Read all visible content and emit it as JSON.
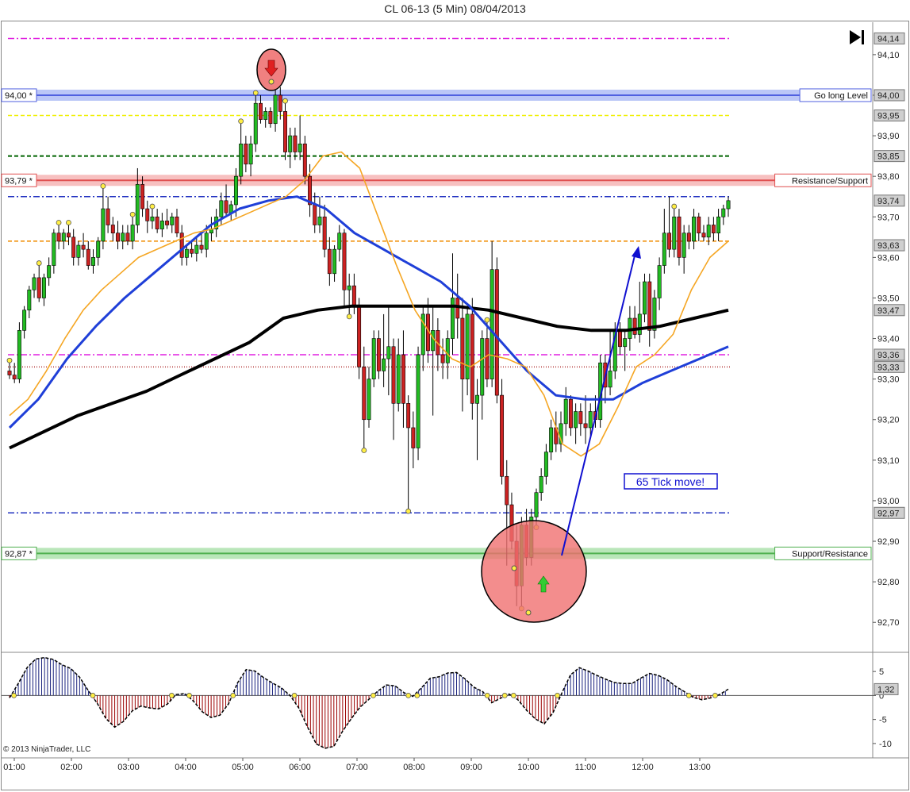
{
  "title": "CL 06-13 (5 Min)  08/04/2013",
  "copyright": "© 2013 NinjaTrader, LLC",
  "colors": {
    "up": "#22bb22",
    "down": "#cc2222",
    "sma_fast": "#f5a623",
    "sma_mid": "#1f3fd8",
    "sma_slow": "#000000",
    "osc_up": "#1a237e",
    "osc_down": "#9b0000"
  },
  "chart_data": [
    {
      "type": "candlestick",
      "ylim": [
        92.63,
        94.18
      ],
      "x_labels": [
        "01:00",
        "02:00",
        "03:00",
        "04:00",
        "05:00",
        "06:00",
        "07:00",
        "08:00",
        "09:00",
        "10:00",
        "11:00",
        "12:00",
        "13:00"
      ],
      "y_ticks": [
        "94,10",
        "94,00",
        "93,90",
        "93,80",
        "93,70",
        "93,60",
        "93,50",
        "93,40",
        "93,30",
        "93,20",
        "93,10",
        "93,00",
        "92,90",
        "92,80",
        "92,70"
      ],
      "y_tick_values": [
        94.1,
        94.0,
        93.9,
        93.8,
        93.7,
        93.6,
        93.5,
        93.4,
        93.3,
        93.2,
        93.1,
        93.0,
        92.9,
        92.8,
        92.7
      ],
      "price_tags": [
        {
          "label": "94,14",
          "value": 94.14,
          "color": "#cfcfcf"
        },
        {
          "label": "94,00",
          "value": 94.0,
          "color": "#cfcfcf"
        },
        {
          "label": "93,95",
          "value": 93.95,
          "color": "#cfcfcf"
        },
        {
          "label": "93,85",
          "value": 93.85,
          "color": "#cfcfcf"
        },
        {
          "label": "93,74",
          "value": 93.74,
          "color": "#cfcfcf"
        },
        {
          "label": "93,63",
          "value": 93.63,
          "color": "#cfcfcf"
        },
        {
          "label": "93,47",
          "value": 93.47,
          "color": "#cfcfcf"
        },
        {
          "label": "93,36",
          "value": 93.36,
          "color": "#cfcfcf"
        },
        {
          "label": "93,33",
          "value": 93.33,
          "color": "#cfcfcf"
        },
        {
          "label": "92,97",
          "value": 92.97,
          "color": "#cfcfcf"
        }
      ],
      "horizontal_lines": [
        {
          "value": 94.14,
          "color": "#e020e0",
          "style": "dashdot"
        },
        {
          "value": 93.95,
          "color": "#f0f000",
          "style": "dash"
        },
        {
          "value": 93.85,
          "color": "#006400",
          "style": "dash"
        },
        {
          "value": 93.75,
          "color": "#2030c0",
          "style": "dashdot"
        },
        {
          "value": 93.64,
          "color": "#f08c00",
          "style": "dash"
        },
        {
          "value": 93.36,
          "color": "#e020e0",
          "style": "dashdot"
        },
        {
          "value": 93.33,
          "color": "#b03030",
          "style": "dot"
        },
        {
          "value": 92.97,
          "color": "#2030c0",
          "style": "dashdot"
        }
      ],
      "zones": [
        {
          "value": 94.0,
          "left_label": "94,00 *",
          "right_label": "Go long Level",
          "fill": "#aab8f5",
          "line": "#5060e0"
        },
        {
          "value": 93.79,
          "left_label": "93,79 *",
          "right_label": "Resistance/Support",
          "fill": "#f5b0b0",
          "line": "#e05050"
        },
        {
          "value": 92.87,
          "left_label": "92,87 *",
          "right_label": "Support/Resistance",
          "fill": "#a8e0a8",
          "line": "#50b050"
        }
      ],
      "annotation": "65 Tick move!",
      "candles": [
        [
          93.32,
          93.34,
          93.3,
          93.31
        ],
        [
          93.31,
          93.34,
          93.29,
          93.3
        ],
        [
          93.3,
          93.44,
          93.29,
          93.42
        ],
        [
          93.42,
          93.48,
          93.4,
          93.47
        ],
        [
          93.47,
          93.53,
          93.45,
          93.52
        ],
        [
          93.52,
          93.56,
          93.5,
          93.55
        ],
        [
          93.55,
          93.58,
          93.49,
          93.5
        ],
        [
          93.5,
          93.56,
          93.48,
          93.55
        ],
        [
          93.55,
          93.6,
          93.53,
          93.58
        ],
        [
          93.58,
          93.67,
          93.56,
          93.66
        ],
        [
          93.66,
          93.68,
          93.62,
          93.64
        ],
        [
          93.64,
          93.67,
          93.62,
          93.66
        ],
        [
          93.66,
          93.68,
          93.63,
          93.65
        ],
        [
          93.65,
          93.67,
          93.58,
          93.6
        ],
        [
          93.6,
          93.64,
          93.58,
          93.63
        ],
        [
          93.63,
          93.66,
          93.6,
          93.62
        ],
        [
          93.62,
          93.64,
          93.57,
          93.58
        ],
        [
          93.58,
          93.62,
          93.56,
          93.6
        ],
        [
          93.6,
          93.65,
          93.58,
          93.64
        ],
        [
          93.64,
          93.77,
          93.62,
          93.72
        ],
        [
          93.72,
          93.75,
          93.66,
          93.68
        ],
        [
          93.68,
          93.7,
          93.64,
          93.66
        ],
        [
          93.66,
          93.69,
          93.62,
          93.64
        ],
        [
          93.64,
          93.68,
          93.62,
          93.66
        ],
        [
          93.66,
          93.68,
          93.63,
          93.64
        ],
        [
          93.64,
          93.7,
          93.62,
          93.68
        ],
        [
          93.68,
          93.82,
          93.66,
          93.78
        ],
        [
          93.78,
          93.8,
          93.7,
          93.72
        ],
        [
          93.72,
          93.74,
          93.66,
          93.69
        ],
        [
          93.69,
          93.72,
          93.67,
          93.7
        ],
        [
          93.7,
          93.72,
          93.66,
          93.67
        ],
        [
          93.67,
          93.71,
          93.65,
          93.69
        ],
        [
          93.69,
          93.72,
          93.67,
          93.68
        ],
        [
          93.68,
          93.71,
          93.66,
          93.7
        ],
        [
          93.7,
          93.72,
          93.65,
          93.66
        ],
        [
          93.66,
          93.68,
          93.58,
          93.6
        ],
        [
          93.6,
          93.63,
          93.58,
          93.62
        ],
        [
          93.62,
          93.64,
          93.6,
          93.61
        ],
        [
          93.61,
          93.65,
          93.59,
          93.63
        ],
        [
          93.63,
          93.66,
          93.61,
          93.62
        ],
        [
          93.62,
          93.68,
          93.6,
          93.66
        ],
        [
          93.66,
          93.7,
          93.64,
          93.67
        ],
        [
          93.67,
          93.72,
          93.65,
          93.7
        ],
        [
          93.7,
          93.76,
          93.68,
          93.74
        ],
        [
          93.74,
          93.78,
          93.7,
          93.71
        ],
        [
          93.71,
          93.74,
          93.69,
          93.73
        ],
        [
          93.73,
          93.82,
          93.7,
          93.8
        ],
        [
          93.8,
          93.93,
          93.78,
          93.88
        ],
        [
          93.88,
          93.9,
          93.81,
          93.83
        ],
        [
          93.83,
          93.9,
          93.8,
          93.88
        ],
        [
          93.88,
          94.0,
          93.86,
          93.98
        ],
        [
          93.98,
          94.0,
          93.93,
          93.94
        ],
        [
          93.94,
          93.97,
          93.92,
          93.96
        ],
        [
          93.96,
          93.97,
          93.92,
          93.93
        ],
        [
          93.93,
          94.04,
          93.91,
          94.0
        ],
        [
          94.0,
          94.02,
          93.94,
          93.96
        ],
        [
          93.96,
          93.98,
          93.84,
          93.86
        ],
        [
          93.86,
          93.92,
          93.82,
          93.9
        ],
        [
          93.9,
          93.92,
          93.84,
          93.86
        ],
        [
          93.86,
          93.95,
          93.84,
          93.88
        ],
        [
          93.88,
          93.9,
          93.78,
          93.8
        ],
        [
          93.8,
          93.83,
          93.7,
          93.73
        ],
        [
          93.73,
          93.76,
          93.66,
          93.68
        ],
        [
          93.68,
          93.75,
          93.66,
          93.7
        ],
        [
          93.7,
          93.73,
          93.6,
          93.62
        ],
        [
          93.62,
          93.65,
          93.53,
          93.56
        ],
        [
          93.56,
          93.63,
          93.54,
          93.62
        ],
        [
          93.62,
          93.68,
          93.59,
          93.66
        ],
        [
          93.66,
          93.67,
          93.48,
          93.52
        ],
        [
          93.52,
          93.56,
          93.46,
          93.53
        ],
        [
          93.53,
          93.56,
          93.46,
          93.48
        ],
        [
          93.48,
          93.5,
          93.3,
          93.33
        ],
        [
          93.33,
          93.38,
          93.13,
          93.2
        ],
        [
          93.2,
          93.33,
          93.18,
          93.3
        ],
        [
          93.3,
          93.42,
          93.28,
          93.4
        ],
        [
          93.4,
          93.42,
          93.3,
          93.32
        ],
        [
          93.32,
          93.46,
          93.28,
          93.35
        ],
        [
          93.35,
          93.48,
          93.26,
          93.38
        ],
        [
          93.38,
          93.4,
          93.15,
          93.24
        ],
        [
          93.24,
          93.4,
          93.22,
          93.36
        ],
        [
          93.36,
          93.42,
          93.18,
          93.24
        ],
        [
          93.24,
          93.26,
          92.98,
          93.18
        ],
        [
          93.18,
          93.22,
          93.08,
          93.13
        ],
        [
          93.13,
          93.38,
          93.1,
          93.36
        ],
        [
          93.36,
          93.48,
          93.32,
          93.46
        ],
        [
          93.46,
          93.5,
          93.34,
          93.37
        ],
        [
          93.37,
          93.48,
          93.21,
          93.42
        ],
        [
          93.42,
          93.45,
          93.32,
          93.36
        ],
        [
          93.36,
          93.4,
          93.3,
          93.34
        ],
        [
          93.34,
          93.42,
          93.3,
          93.4
        ],
        [
          93.4,
          93.61,
          93.36,
          93.5
        ],
        [
          93.5,
          93.56,
          93.4,
          93.45
        ],
        [
          93.45,
          93.5,
          93.22,
          93.3
        ],
        [
          93.3,
          93.48,
          93.26,
          93.46
        ],
        [
          93.46,
          93.5,
          93.2,
          93.24
        ],
        [
          93.24,
          93.3,
          93.1,
          93.26
        ],
        [
          93.26,
          93.42,
          93.2,
          93.4
        ],
        [
          93.4,
          93.44,
          93.28,
          93.3
        ],
        [
          93.3,
          93.64,
          93.28,
          93.57
        ],
        [
          93.57,
          93.6,
          93.24,
          93.26
        ],
        [
          93.26,
          93.3,
          93.04,
          93.06
        ],
        [
          93.06,
          93.1,
          92.84,
          92.99
        ],
        [
          92.99,
          93.02,
          92.88,
          92.9
        ],
        [
          92.9,
          92.94,
          92.74,
          92.79
        ],
        [
          92.79,
          92.96,
          92.74,
          92.94
        ],
        [
          92.94,
          92.98,
          92.84,
          92.86
        ],
        [
          92.86,
          92.98,
          92.84,
          92.96
        ],
        [
          92.96,
          93.03,
          92.94,
          93.02
        ],
        [
          93.02,
          93.08,
          93.0,
          93.06
        ],
        [
          93.06,
          93.14,
          93.04,
          93.12
        ],
        [
          93.12,
          93.2,
          93.1,
          93.18
        ],
        [
          93.18,
          93.22,
          93.12,
          93.14
        ],
        [
          93.14,
          93.22,
          93.12,
          93.19
        ],
        [
          93.19,
          93.28,
          93.16,
          93.25
        ],
        [
          93.25,
          93.26,
          93.16,
          93.18
        ],
        [
          93.18,
          93.24,
          93.14,
          93.22
        ],
        [
          93.22,
          93.24,
          93.16,
          93.19
        ],
        [
          93.19,
          93.26,
          93.14,
          93.18
        ],
        [
          93.18,
          93.24,
          93.16,
          93.22
        ],
        [
          93.22,
          93.26,
          93.18,
          93.2
        ],
        [
          93.2,
          93.36,
          93.18,
          93.34
        ],
        [
          93.34,
          93.36,
          93.24,
          93.28
        ],
        [
          93.28,
          93.42,
          93.26,
          93.32
        ],
        [
          93.32,
          93.44,
          93.3,
          93.42
        ],
        [
          93.42,
          93.44,
          93.36,
          93.38
        ],
        [
          93.38,
          93.42,
          93.32,
          93.4
        ],
        [
          93.4,
          93.48,
          93.37,
          93.45
        ],
        [
          93.45,
          93.48,
          93.4,
          93.41
        ],
        [
          93.41,
          93.54,
          93.39,
          93.46
        ],
        [
          93.46,
          93.56,
          93.44,
          93.54
        ],
        [
          93.54,
          93.56,
          93.38,
          93.42
        ],
        [
          93.42,
          93.52,
          93.4,
          93.5
        ],
        [
          93.5,
          93.6,
          93.47,
          93.58
        ],
        [
          93.58,
          93.72,
          93.56,
          93.66
        ],
        [
          93.66,
          93.75,
          93.6,
          93.62
        ],
        [
          93.62,
          93.72,
          93.6,
          93.7
        ],
        [
          93.7,
          93.72,
          93.58,
          93.6
        ],
        [
          93.6,
          93.68,
          93.56,
          93.66
        ],
        [
          93.66,
          93.68,
          93.62,
          93.64
        ],
        [
          93.64,
          93.72,
          93.62,
          93.7
        ],
        [
          93.7,
          93.71,
          93.64,
          93.66
        ],
        [
          93.66,
          93.68,
          93.64,
          93.65
        ],
        [
          93.65,
          93.7,
          93.63,
          93.68
        ],
        [
          93.68,
          93.7,
          93.64,
          93.66
        ],
        [
          93.66,
          93.72,
          93.64,
          93.7
        ],
        [
          93.7,
          93.73,
          93.68,
          93.72
        ],
        [
          93.72,
          93.75,
          93.7,
          93.74
        ]
      ],
      "sma_fast": [
        93.21,
        93.25,
        93.32,
        93.4,
        93.47,
        93.52,
        93.56,
        93.6,
        93.62,
        93.64,
        93.66,
        93.67,
        93.69,
        93.71,
        93.73,
        93.75,
        93.79,
        93.85,
        93.86,
        93.82,
        93.7,
        93.58,
        93.47,
        93.4,
        93.35,
        93.33,
        93.36,
        93.35,
        93.33,
        93.26,
        93.14,
        93.11,
        93.14,
        93.23,
        93.33,
        93.36,
        93.41,
        93.52,
        93.6,
        93.64
      ],
      "sma_mid": [
        93.18,
        93.25,
        93.35,
        93.43,
        93.5,
        93.56,
        93.62,
        93.68,
        93.72,
        93.74,
        93.75,
        93.72,
        93.66,
        93.62,
        93.58,
        93.54,
        93.48,
        93.4,
        93.32,
        93.26,
        93.25,
        93.25,
        93.29,
        93.32,
        93.35,
        93.38
      ],
      "sma_slow": [
        93.13,
        93.17,
        93.21,
        93.24,
        93.27,
        93.31,
        93.35,
        93.39,
        93.45,
        93.47,
        93.48,
        93.48,
        93.48,
        93.48,
        93.47,
        93.45,
        93.43,
        93.42,
        93.42,
        93.43,
        93.45,
        93.47
      ],
      "swing_high_idx": [
        0,
        6,
        10,
        12,
        19,
        25,
        29,
        47,
        50,
        54,
        56,
        97,
        135
      ],
      "swing_low_idx": [
        69,
        72,
        81,
        104,
        107
      ],
      "oscillator": {
        "y_ticks": [
          "5",
          "0",
          "-5",
          "-10"
        ],
        "y_tick_values": [
          5,
          0,
          -5,
          -10
        ],
        "ylim": [
          -12.5,
          8.5
        ],
        "current_label": "1,32",
        "current_value": 1.32,
        "values": [
          -0.5,
          2.5,
          5.8,
          7.6,
          7.9,
          7.5,
          6.4,
          5.6,
          3.8,
          1.0,
          -1.6,
          -4.8,
          -6.6,
          -5.4,
          -3.2,
          -2.2,
          -2.6,
          -2.8,
          -1.8,
          0.2,
          0.4,
          -1.2,
          -3.4,
          -4.6,
          -4.1,
          -1.7,
          2.6,
          5.4,
          5.1,
          3.7,
          2.6,
          1.6,
          0.0,
          -2.6,
          -6.6,
          -10.1,
          -11.0,
          -10.6,
          -7.4,
          -4.8,
          -2.4,
          -0.8,
          0.9,
          2.2,
          2.0,
          0.6,
          -0.2,
          1.6,
          3.6,
          3.9,
          4.7,
          4.8,
          3.4,
          1.7,
          0.8,
          -1.5,
          -0.6,
          0.3,
          -0.9,
          -3.1,
          -4.9,
          -5.9,
          -3.6,
          0.5,
          4.3,
          5.8,
          5.1,
          4.2,
          3.4,
          2.7,
          2.5,
          2.5,
          3.6,
          4.6,
          4.2,
          3.3,
          1.9,
          0.8,
          -0.4,
          -0.9,
          -0.5,
          0.2,
          1.32
        ]
      }
    }
  ]
}
